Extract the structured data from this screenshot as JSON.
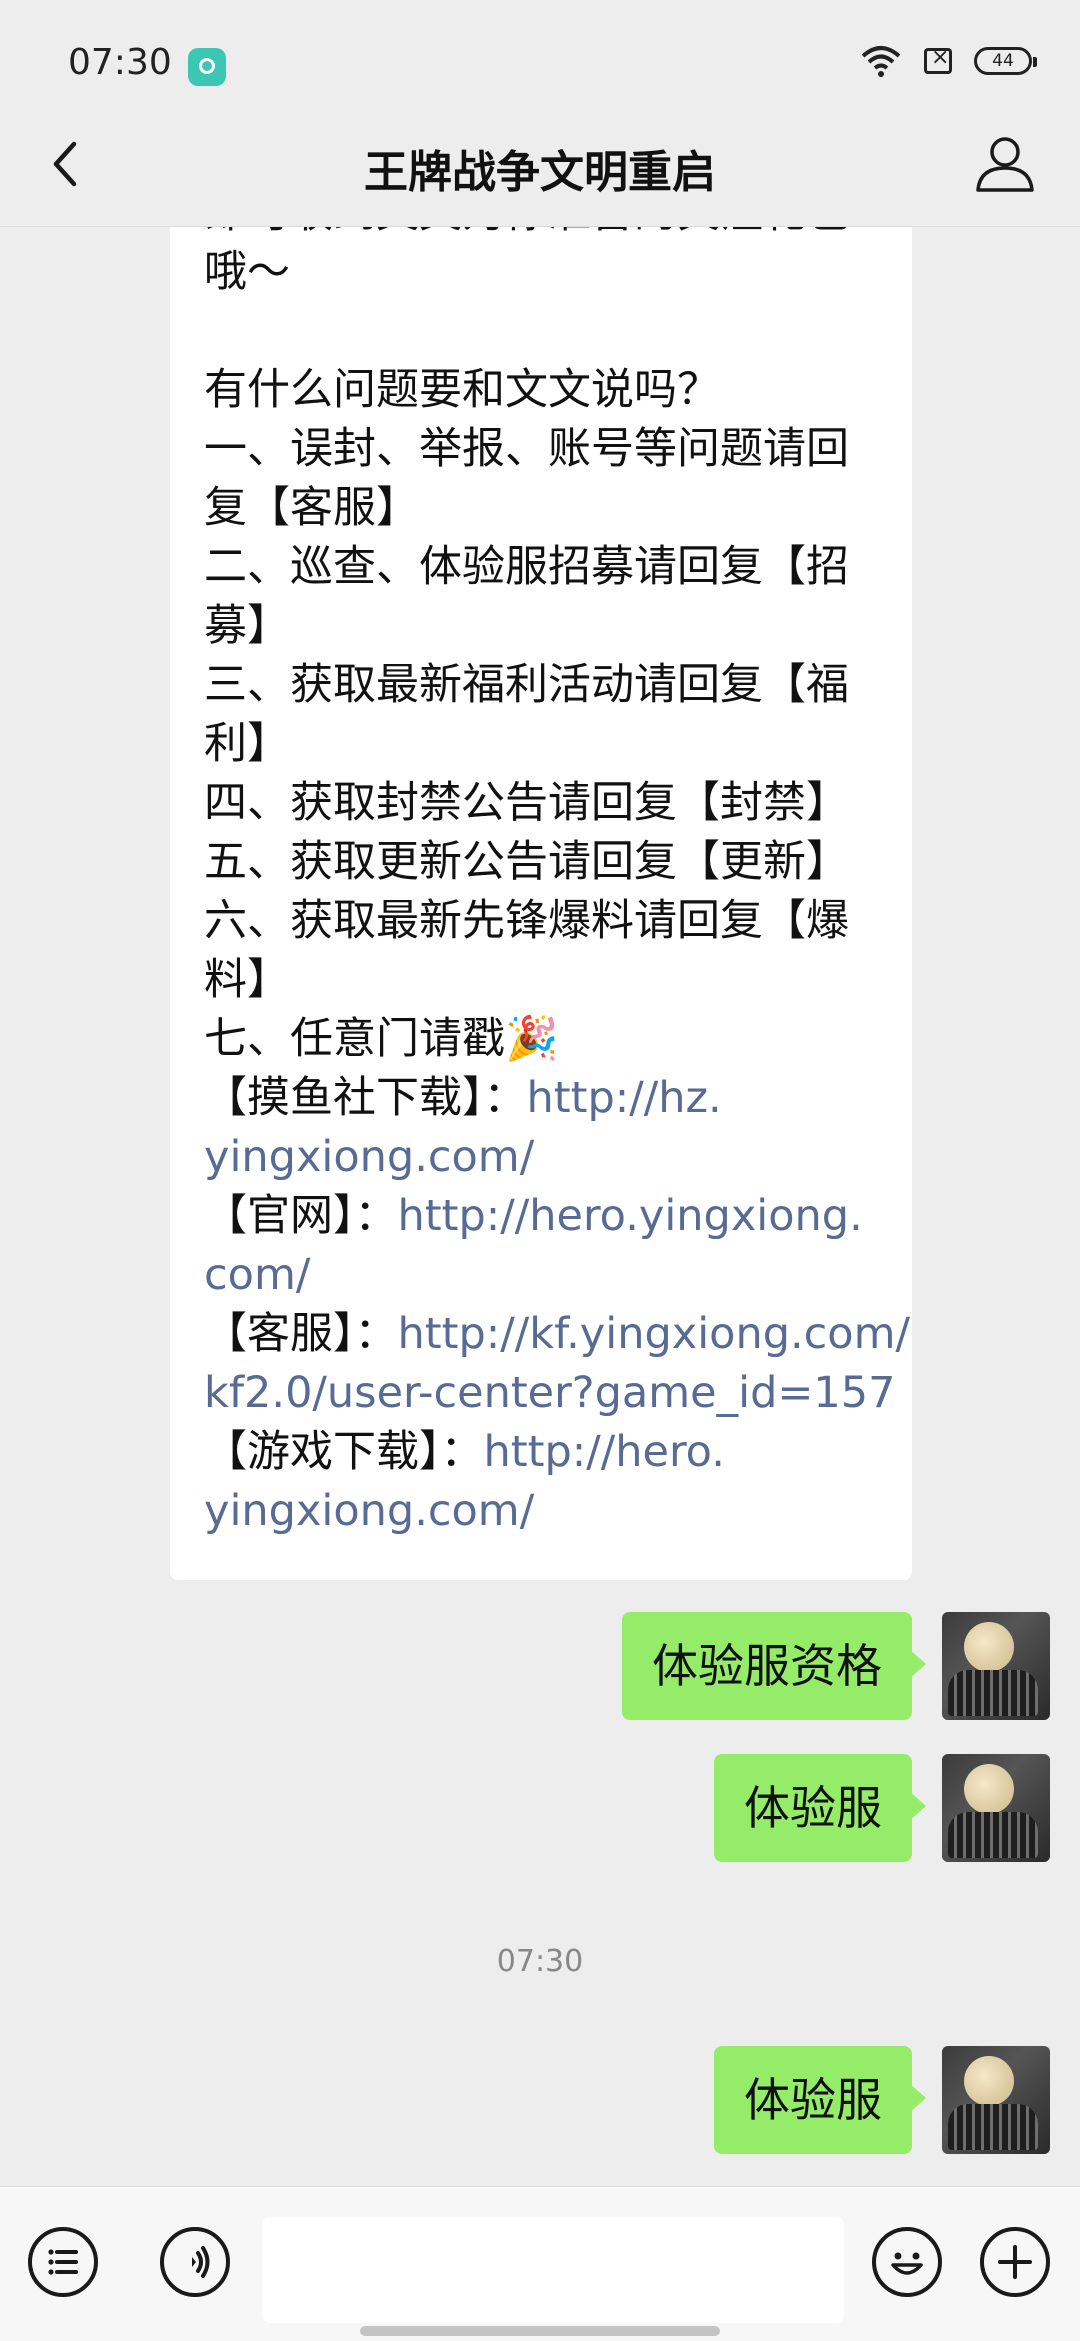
{
  "status_bar": {
    "time": "07:30",
    "battery": "44"
  },
  "nav": {
    "title": "王牌战争文明重启"
  },
  "incoming_message": {
    "lines": [
      {
        "text": "即可收到文文为你准备的关注礼包"
      },
      {
        "text": "哦～"
      },
      {
        "text": ""
      },
      {
        "text": "有什么问题要和文文说吗？"
      },
      {
        "text": "一、误封、举报、账号等问题请回"
      },
      {
        "text": "复【客服】"
      },
      {
        "text": "二、巡查、体验服招募请回复【招"
      },
      {
        "text": "募】"
      },
      {
        "text": "三、获取最新福利活动请回复【福"
      },
      {
        "text": "利】"
      },
      {
        "text": "四、获取封禁公告请回复【封禁】"
      },
      {
        "text": "五、获取更新公告请回复【更新】"
      },
      {
        "text": "六、获取最新先锋爆料请回复【爆"
      },
      {
        "text": "料】"
      },
      {
        "text": "七、任意门请戳🎉"
      },
      {
        "text": "【摸鱼社下载】：",
        "link": "http://hz."
      },
      {
        "text": "",
        "link": "yingxiong.com/"
      },
      {
        "text": "【官网】：",
        "link": "http://hero.yingxiong."
      },
      {
        "text": "",
        "link": "com/"
      },
      {
        "text": "【客服】：",
        "link": "http://kf.yingxiong.com/"
      },
      {
        "text": "",
        "link": "kf2.0/user-center?game_id=157"
      },
      {
        "text": "【游戏下载】：",
        "link": "http://hero."
      },
      {
        "text": "",
        "link": "yingxiong.com/"
      }
    ]
  },
  "outgoing_messages": [
    {
      "text": "体验服资格"
    },
    {
      "text": "体验服"
    },
    {
      "text": "体验服"
    }
  ],
  "timestamp": "07:30",
  "input_bar": {
    "placeholder": ""
  }
}
